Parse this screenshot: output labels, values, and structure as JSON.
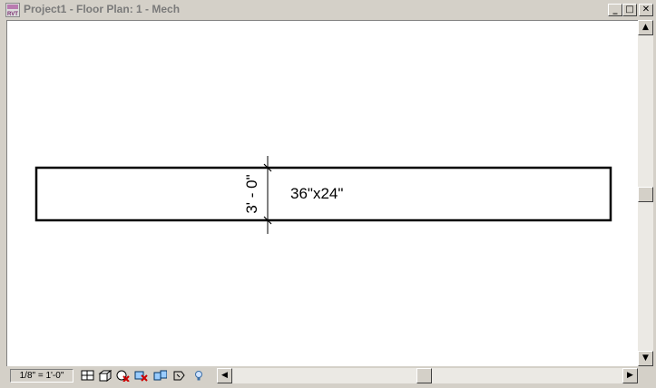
{
  "window": {
    "title": "Project1 - Floor Plan: 1 - Mech",
    "icon_label": "RVT",
    "minimize_glyph": "_",
    "maximize_glyph": "□",
    "close_glyph": "✕"
  },
  "drawing": {
    "duct_size_label": "36\"x24\"",
    "dimension_label": "3' - 0\""
  },
  "status": {
    "scale": "1/8\" = 1'-0\""
  },
  "toolbar_icons": [
    "detail-level-icon",
    "model-graphics-style-icon",
    "shadows-off-icon",
    "temporary-hide-icon",
    "reveal-hidden-icon",
    "crop-region-icon",
    "lightbulb-icon"
  ],
  "scroll": {
    "up_glyph": "▲",
    "down_glyph": "▼",
    "left_glyph": "◀",
    "right_glyph": "▶"
  }
}
